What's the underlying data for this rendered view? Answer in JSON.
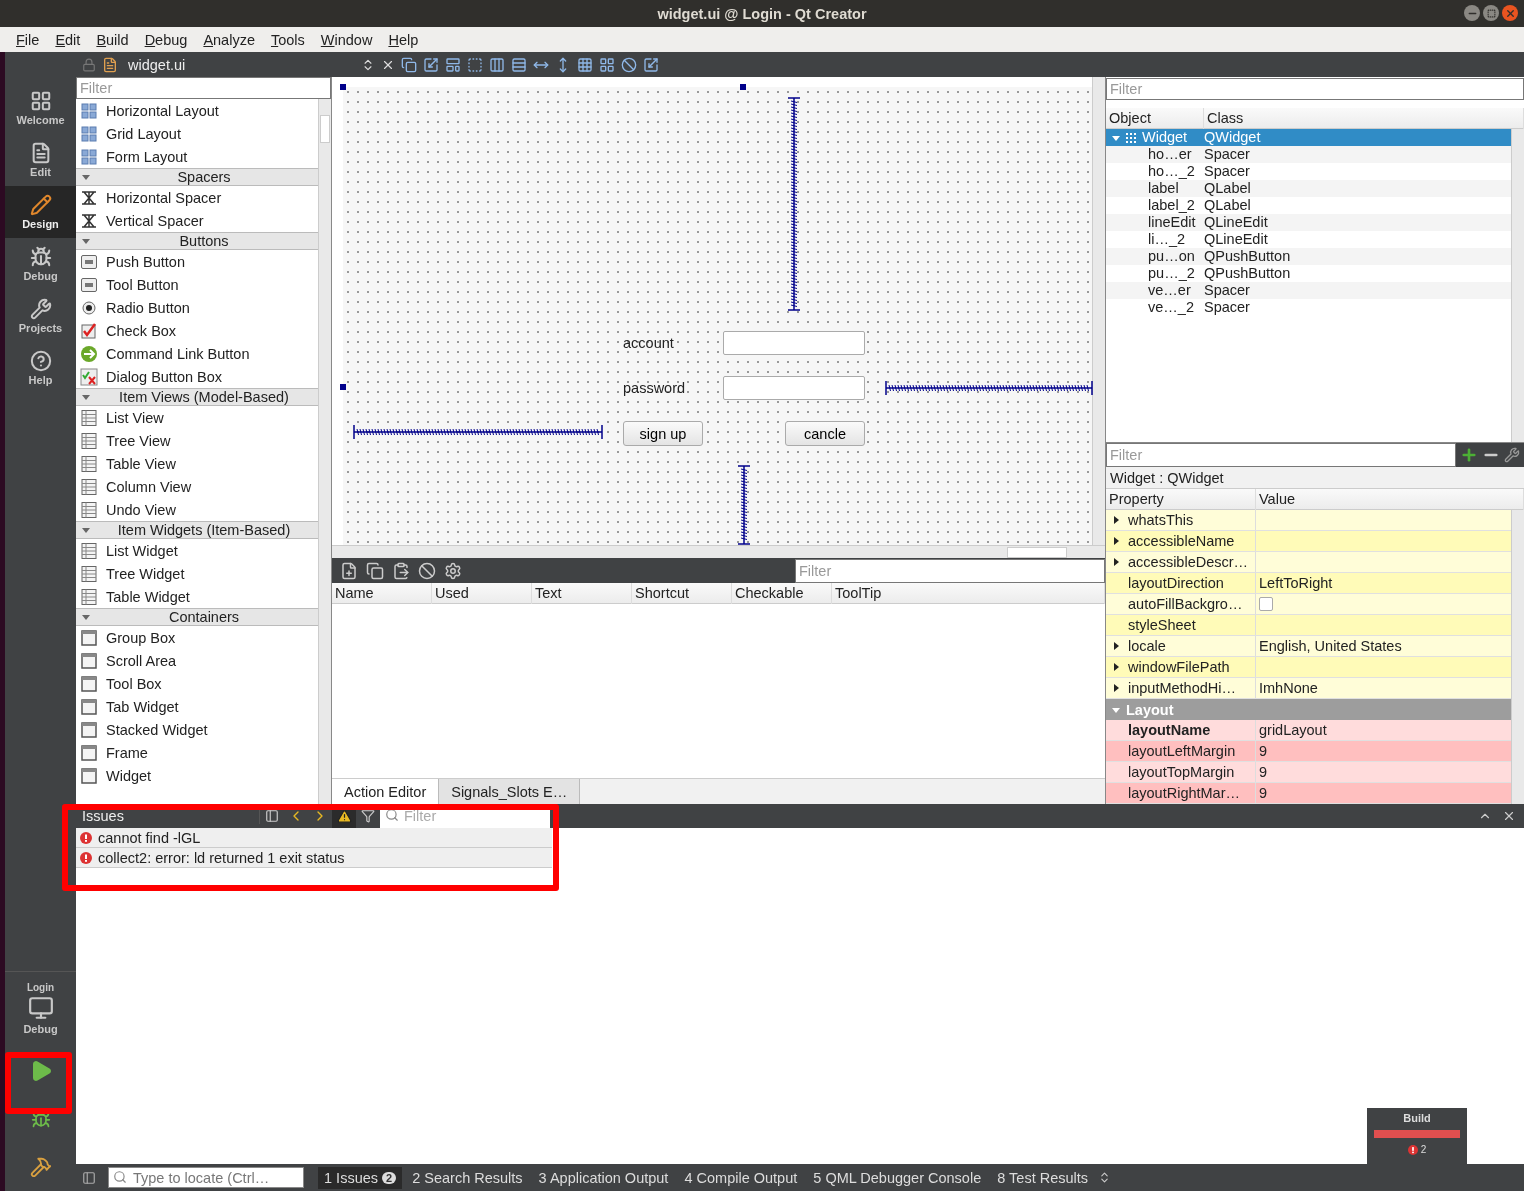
{
  "window": {
    "title": "widget.ui @ Login - Qt Creator"
  },
  "menu": [
    {
      "label": "File"
    },
    {
      "label": "Edit"
    },
    {
      "label": "Build"
    },
    {
      "label": "Debug"
    },
    {
      "label": "Analyze"
    },
    {
      "label": "Tools"
    },
    {
      "label": "Window"
    },
    {
      "label": "Help"
    }
  ],
  "modes": [
    {
      "label": "Welcome",
      "selected": false
    },
    {
      "label": "Edit",
      "selected": false
    },
    {
      "label": "Design",
      "selected": true
    },
    {
      "label": "Debug",
      "selected": false
    },
    {
      "label": "Projects",
      "selected": false
    },
    {
      "label": "Help",
      "selected": false
    }
  ],
  "target": {
    "project": "Login",
    "config": "Debug"
  },
  "editor_toolbar": {
    "file": "widget.ui"
  },
  "widget_box": {
    "filter_placeholder": "Filter",
    "items": [
      {
        "kind": "item",
        "label": "Horizontal Layout"
      },
      {
        "kind": "item",
        "label": "Grid Layout"
      },
      {
        "kind": "item",
        "label": "Form Layout"
      },
      {
        "kind": "category",
        "label": "Spacers",
        "expanded": true
      },
      {
        "kind": "item",
        "label": "Horizontal Spacer"
      },
      {
        "kind": "item",
        "label": "Vertical Spacer"
      },
      {
        "kind": "category",
        "label": "Buttons",
        "expanded": true
      },
      {
        "kind": "item",
        "label": "Push Button"
      },
      {
        "kind": "item",
        "label": "Tool Button"
      },
      {
        "kind": "item",
        "label": "Radio Button"
      },
      {
        "kind": "item",
        "label": "Check Box"
      },
      {
        "kind": "item",
        "label": "Command Link Button"
      },
      {
        "kind": "item",
        "label": "Dialog Button Box"
      },
      {
        "kind": "category",
        "label": "Item Views (Model-Based)",
        "expanded": true
      },
      {
        "kind": "item",
        "label": "List View"
      },
      {
        "kind": "item",
        "label": "Tree View"
      },
      {
        "kind": "item",
        "label": "Table View"
      },
      {
        "kind": "item",
        "label": "Column View"
      },
      {
        "kind": "item",
        "label": "Undo View"
      },
      {
        "kind": "category",
        "label": "Item Widgets (Item-Based)",
        "expanded": true
      },
      {
        "kind": "item",
        "label": "List Widget"
      },
      {
        "kind": "item",
        "label": "Tree Widget"
      },
      {
        "kind": "item",
        "label": "Table Widget"
      },
      {
        "kind": "category",
        "label": "Containers",
        "expanded": true
      },
      {
        "kind": "item",
        "label": "Group Box"
      },
      {
        "kind": "item",
        "label": "Scroll Area"
      },
      {
        "kind": "item",
        "label": "Tool Box"
      },
      {
        "kind": "item",
        "label": "Tab Widget"
      },
      {
        "kind": "item",
        "label": "Stacked Widget"
      },
      {
        "kind": "item",
        "label": "Frame"
      },
      {
        "kind": "item",
        "label": "Widget"
      }
    ]
  },
  "form": {
    "widgets": [
      {
        "kind": "v_spacer"
      },
      {
        "kind": "label",
        "text": "account"
      },
      {
        "kind": "line_edit"
      },
      {
        "kind": "label",
        "text": "password"
      },
      {
        "kind": "line_edit"
      },
      {
        "kind": "h_spacer"
      },
      {
        "kind": "h_spacer"
      },
      {
        "kind": "button",
        "text": "sign up"
      },
      {
        "kind": "button",
        "text": "cancle"
      },
      {
        "kind": "v_spacer"
      }
    ]
  },
  "action_editor": {
    "filter_placeholder": "Filter",
    "columns": [
      "Name",
      "Used",
      "Text",
      "Shortcut",
      "Checkable",
      "ToolTip"
    ],
    "tabs": [
      {
        "label": "Action Editor",
        "selected": true
      },
      {
        "label": "Signals_Slots E…",
        "selected": false
      }
    ]
  },
  "object_inspector": {
    "filter_placeholder": "Filter",
    "columns": [
      "Object",
      "Class"
    ],
    "rows": [
      {
        "object": "Widget",
        "class": "QWidget",
        "selected": true,
        "expanded": true,
        "children": [
          {
            "object": "ho…er",
            "class": "Spacer",
            "selected": false
          },
          {
            "object": "ho…_2",
            "class": "Spacer",
            "selected": false
          },
          {
            "object": "label",
            "class": "QLabel",
            "selected": false
          },
          {
            "object": "label_2",
            "class": "QLabel",
            "selected": false
          },
          {
            "object": "lineEdit",
            "class": "QLineEdit",
            "selected": false
          },
          {
            "object": "li…_2",
            "class": "QLineEdit",
            "selected": false
          },
          {
            "object": "pu…on",
            "class": "QPushButton",
            "selected": false
          },
          {
            "object": "pu…_2",
            "class": "QPushButton",
            "selected": false
          },
          {
            "object": "ve…er",
            "class": "Spacer",
            "selected": false
          },
          {
            "object": "ve…_2",
            "class": "Spacer",
            "selected": false
          }
        ]
      }
    ]
  },
  "property_editor": {
    "filter_placeholder": "Filter",
    "title": "Widget : QWidget",
    "columns": [
      "Property",
      "Value"
    ],
    "sections": [
      {
        "color": "#fffbb8",
        "rows": [
          {
            "name": "whatsThis",
            "expandable": true,
            "modified": false
          },
          {
            "name": "accessibleName",
            "expandable": true,
            "modified": false
          },
          {
            "name": "accessibleDescr…",
            "expandable": true,
            "modified": false
          },
          {
            "name": "layoutDirection",
            "value": "LeftToRight",
            "expandable": false,
            "modified": false
          },
          {
            "name": "autoFillBackgro…",
            "kind": "checkbox",
            "checked": false,
            "expandable": false,
            "modified": false
          },
          {
            "name": "styleSheet",
            "expandable": false,
            "modified": false
          },
          {
            "name": "locale",
            "value": "English, United States",
            "expandable": true,
            "modified": false
          },
          {
            "name": "windowFilePath",
            "expandable": true,
            "modified": false
          },
          {
            "name": "inputMethodHi…",
            "value": "ImhNone",
            "expandable": true,
            "modified": false
          }
        ]
      },
      {
        "title": "Layout",
        "expanded": true,
        "color": "#ffbfbf",
        "rows": [
          {
            "name": "layoutName",
            "value": "gridLayout",
            "expandable": false,
            "modified": true
          },
          {
            "name": "layoutLeftMargin",
            "value": "9",
            "expandable": false,
            "modified": false
          },
          {
            "name": "layoutTopMargin",
            "value": "9",
            "expandable": false,
            "modified": false
          },
          {
            "name": "layoutRightMar…",
            "value": "9",
            "expandable": false,
            "modified": false
          }
        ]
      }
    ]
  },
  "issues": {
    "title": "Issues",
    "filter_placeholder": "Filter",
    "rows": [
      {
        "text": "cannot find -lGL"
      },
      {
        "text": "collect2: error: ld returned 1 exit status"
      }
    ]
  },
  "build_progress": {
    "title": "Build",
    "errors": "2",
    "level": 1
  },
  "status_bar": {
    "locate_placeholder": "Type to locate (Ctrl…",
    "panes": [
      {
        "number": "1",
        "label": "Issues",
        "badge": "2",
        "selected": true
      },
      {
        "number": "2",
        "label": "Search Results",
        "selected": false
      },
      {
        "number": "3",
        "label": "Application Output",
        "selected": false
      },
      {
        "number": "4",
        "label": "Compile Output",
        "selected": false
      },
      {
        "number": "5",
        "label": "QML Debugger Console",
        "selected": false
      },
      {
        "number": "8",
        "label": "Test Results",
        "selected": false
      }
    ]
  }
}
